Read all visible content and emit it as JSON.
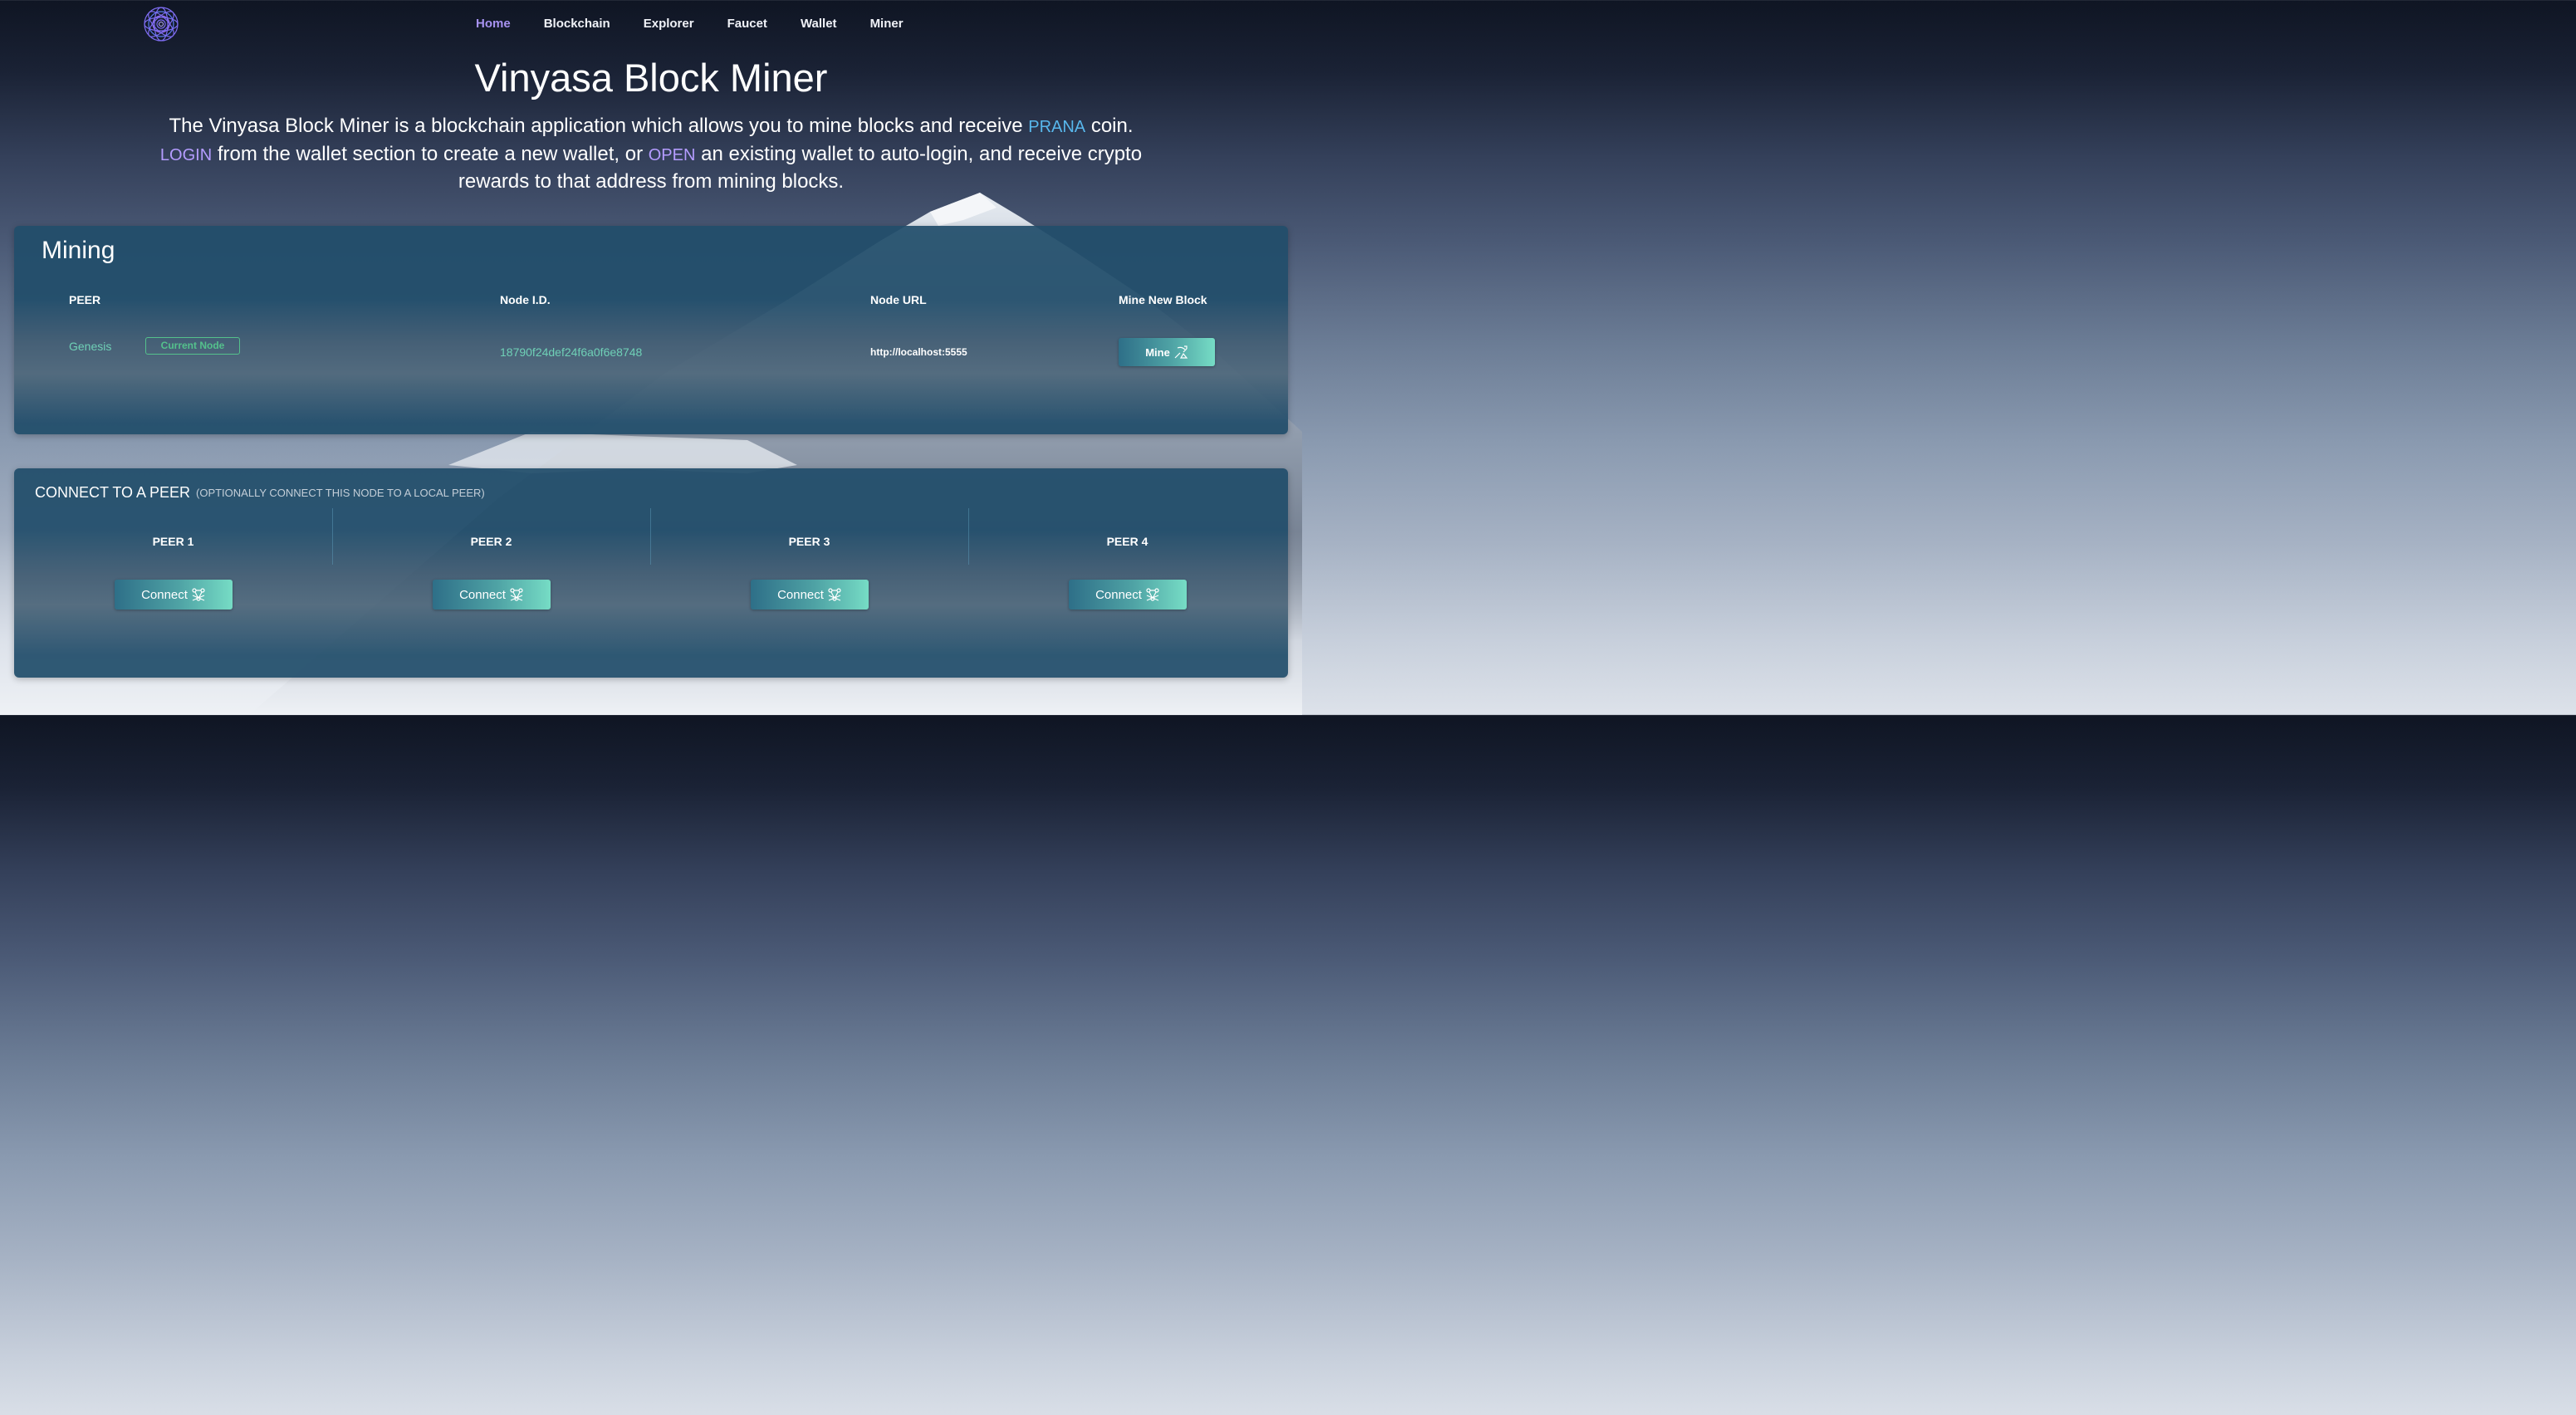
{
  "nav": {
    "links": [
      "Home",
      "Blockchain",
      "Explorer",
      "Faucet",
      "Wallet",
      "Miner"
    ],
    "active": "Home"
  },
  "hero": {
    "title": "Vinyasa Block Miner",
    "line1_a": "The Vinyasa Block Miner is a blockchain application which allows you to mine blocks and receive",
    "prana": "PRANA",
    "line1_b": "coin.",
    "login": "LOGIN",
    "line2_a": "from the wallet section to create a new wallet, or",
    "open": "OPEN",
    "line2_b": "an existing wallet to auto-login, and receive crypto rewards to that address from mining blocks."
  },
  "mining": {
    "title": "Mining",
    "headers": {
      "peer": "PEER",
      "node_id": "Node I.D.",
      "node_url": "Node URL",
      "mine_new_block": "Mine New Block"
    },
    "row": {
      "peer": "Genesis",
      "badge": "Current Node",
      "node_id": "18790f24def24f6a0f6e8748",
      "node_url": "http://localhost:5555",
      "mine_label": "Mine"
    }
  },
  "connect": {
    "title": "CONNECT TO A PEER",
    "subtitle": "(OPTIONALLY CONNECT THIS NODE TO A LOCAL PEER)",
    "peers": [
      {
        "label": "PEER 1",
        "button": "Connect"
      },
      {
        "label": "PEER 2",
        "button": "Connect"
      },
      {
        "label": "PEER 3",
        "button": "Connect"
      },
      {
        "label": "PEER 4",
        "button": "Connect"
      }
    ]
  },
  "icons": {
    "logo": "mandala-logo-icon",
    "mine": "mining-pick-icon",
    "connect": "network-nodes-icon"
  },
  "colors": {
    "accent_purple": "#a792f0",
    "prana_blue": "#58b7ec",
    "node_green": "#6fd0b6",
    "badge_green": "#54c18c",
    "panel_bg": "#214d6a"
  }
}
